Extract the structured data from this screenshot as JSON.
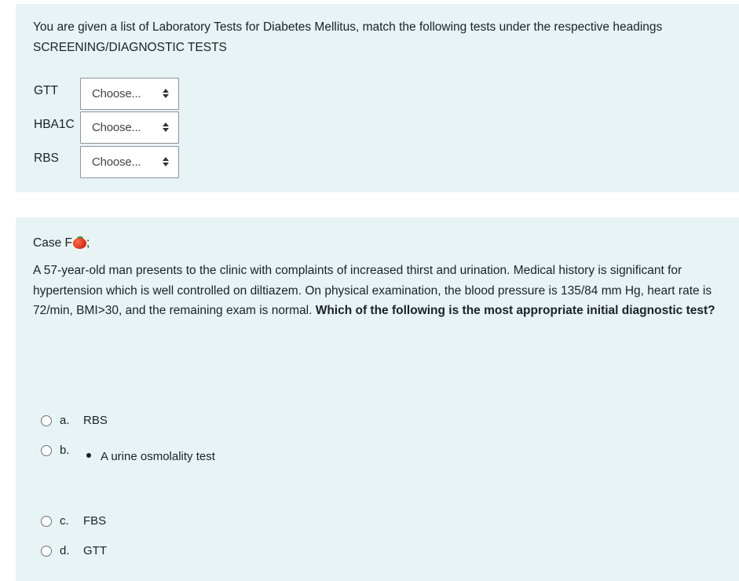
{
  "question1": {
    "text_line1": "You are given a list of Laboratory Tests for Diabetes Mellitus, match the following tests under the respective headings",
    "text_line2": "SCREENING/DIAGNOSTIC TESTS",
    "rows": [
      {
        "label": "GTT",
        "selected": "Choose..."
      },
      {
        "label": "HBA1C",
        "selected": "Choose..."
      },
      {
        "label": "RBS",
        "selected": "Choose..."
      }
    ]
  },
  "question2": {
    "case_prefix": "Case F",
    "case_icon": "tomato-emoji",
    "case_suffix": ";",
    "stem_plain": "A 57-year-old man presents to the clinic with complaints of increased thirst and urination. Medical history is significant for hypertension which is well controlled on diltiazem. On physical examination, the blood pressure is 135/84 mm Hg, heart rate is 72/min, BMI>30, and the remaining exam is normal. ",
    "stem_bold": "Which of the following is the most appropriate initial diagnostic test?",
    "options": [
      {
        "letter": "a.",
        "text": "RBS"
      },
      {
        "letter": "b.",
        "text": "A urine osmolality test"
      },
      {
        "letter": "c.",
        "text": "FBS"
      },
      {
        "letter": "d.",
        "text": "GTT"
      }
    ]
  }
}
